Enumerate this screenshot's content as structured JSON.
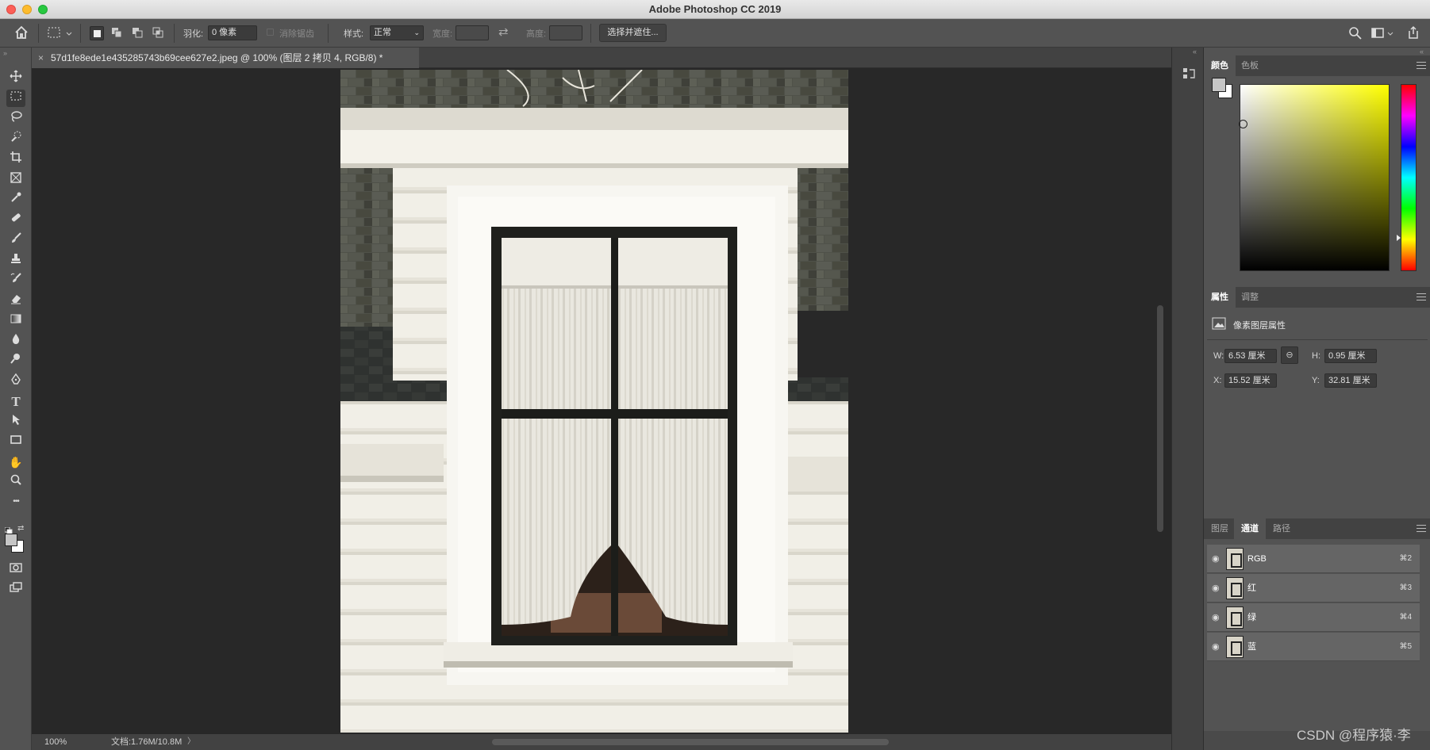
{
  "app": {
    "title": "Adobe Photoshop CC 2019"
  },
  "options_bar": {
    "feather_label": "羽化:",
    "feather_value": "0 像素",
    "antialias_label": "消除锯齿",
    "style_label": "样式:",
    "style_value": "正常",
    "width_label": "宽度:",
    "height_label": "高度:",
    "select_mask_button": "选择并遮住..."
  },
  "document": {
    "tab_title": "57d1fe8ede1e435285743b69cee627e2.jpeg @ 100% (图层 2 拷贝 4, RGB/8) *",
    "close_glyph": "×"
  },
  "status": {
    "zoom": "100%",
    "doc_size": "文档:1.76M/10.8M",
    "arrow": "〉"
  },
  "tools": [
    "move-tool",
    "marquee-tool",
    "lasso-tool",
    "quick-select-tool",
    "crop-tool",
    "frame-tool",
    "eyedropper-tool",
    "healing-brush-tool",
    "brush-tool",
    "clone-stamp-tool",
    "history-brush-tool",
    "eraser-tool",
    "gradient-tool",
    "blur-tool",
    "dodge-tool",
    "pen-tool",
    "type-tool",
    "path-select-tool",
    "rectangle-tool",
    "hand-tool",
    "zoom-tool",
    "more-tools"
  ],
  "tool_glyphs": {
    "type": "T",
    "more": "•••",
    "zoom": "⌕",
    "hand": "✋"
  },
  "color_panel": {
    "tabs": [
      "颜色",
      "色板"
    ],
    "foreground": "#c6c6c6",
    "background": "#ffffff",
    "hue_color": "#ffff00"
  },
  "properties_panel": {
    "tabs": [
      "属性",
      "调整"
    ],
    "heading": "像素图层属性",
    "w_label": "W:",
    "w_value": "6.53 厘米",
    "h_label": "H:",
    "h_value": "0.95 厘米",
    "x_label": "X:",
    "x_value": "15.52 厘米",
    "y_label": "Y:",
    "y_value": "32.81 厘米"
  },
  "channels_panel": {
    "tabs": [
      "图层",
      "通道",
      "路径"
    ],
    "channels": [
      {
        "name": "RGB",
        "shortcut": "⌘2"
      },
      {
        "name": "红",
        "shortcut": "⌘3"
      },
      {
        "name": "绿",
        "shortcut": "⌘4"
      },
      {
        "name": "蓝",
        "shortcut": "⌘5"
      }
    ]
  },
  "watermark": "CSDN @程序猿·李"
}
